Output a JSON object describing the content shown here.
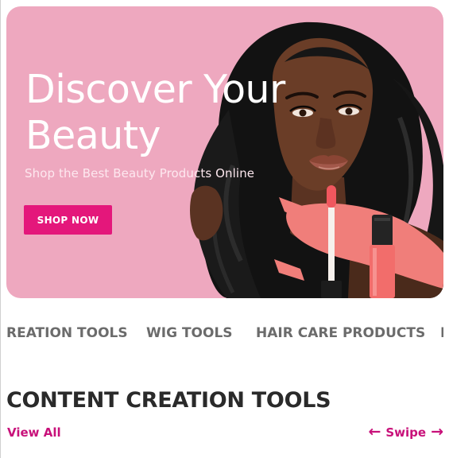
{
  "hero": {
    "title": "Discover Your Beauty",
    "subtitle": "Shop the Best Beauty Products Online",
    "button_label": "SHOP NOW",
    "background_color": "#eea8bf",
    "button_color": "#e4177b"
  },
  "categories": {
    "items": [
      {
        "label": "REATION TOOLS"
      },
      {
        "label": "WIG TOOLS"
      },
      {
        "label": "HAIR CARE PRODUCTS"
      },
      {
        "label": "I"
      }
    ]
  },
  "section": {
    "title": "CONTENT CREATION TOOLS",
    "view_all": "View All",
    "swipe_label": "Swipe",
    "accent_color": "#c8117a",
    "left_icon": "arrow-left-icon",
    "right_icon": "arrow-right-icon"
  }
}
